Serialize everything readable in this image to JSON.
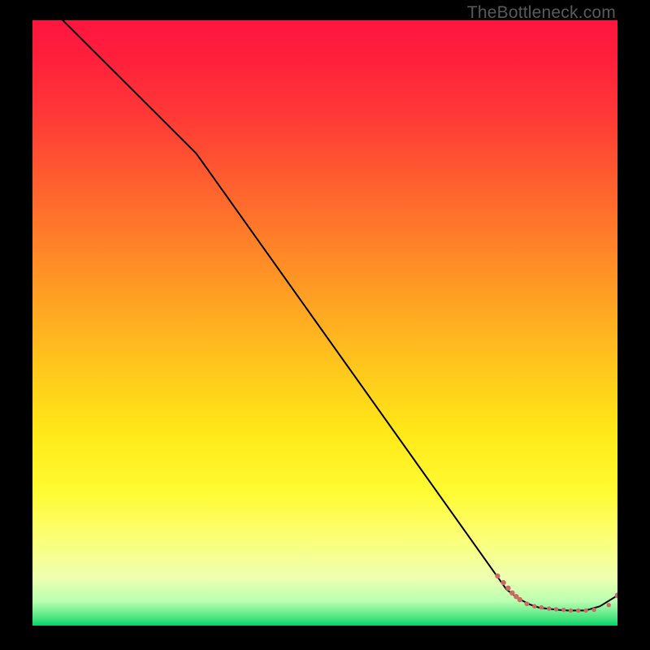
{
  "watermark": "TheBottleneck.com",
  "chart_data": {
    "type": "line",
    "title": "",
    "xlabel": "",
    "ylabel": "",
    "xlim": [
      0,
      100
    ],
    "ylim": [
      0,
      100
    ],
    "grid": false,
    "series": [
      {
        "name": "curve",
        "x": [
          0,
          28,
          81,
          83,
          85,
          86.5,
          88,
          90,
          91.5,
          93,
          94.5,
          97,
          100
        ],
        "y": [
          105,
          78,
          6,
          4.5,
          3.5,
          3,
          2.8,
          2.6,
          2.5,
          2.5,
          2.5,
          3.2,
          5
        ]
      }
    ],
    "markers": {
      "color": "#cc6a63",
      "points_x": [
        79.5,
        80.5,
        81.3,
        82,
        82.7,
        83.3,
        84.5,
        85.8,
        87,
        88.3,
        89.5,
        90.8,
        92,
        93.3,
        94.6,
        96,
        98.5,
        100
      ],
      "points_y": [
        8.2,
        7.1,
        6.2,
        5.4,
        4.8,
        4.3,
        3.6,
        3.2,
        3,
        2.8,
        2.7,
        2.6,
        2.5,
        2.5,
        2.5,
        2.6,
        3.4,
        5
      ],
      "radii": [
        3.2,
        3.2,
        3.2,
        3.2,
        3.2,
        3.2,
        2.9,
        2.7,
        2.7,
        2.7,
        2.7,
        2.7,
        2.7,
        2.7,
        2.7,
        2.7,
        2.7,
        3.4
      ]
    }
  }
}
